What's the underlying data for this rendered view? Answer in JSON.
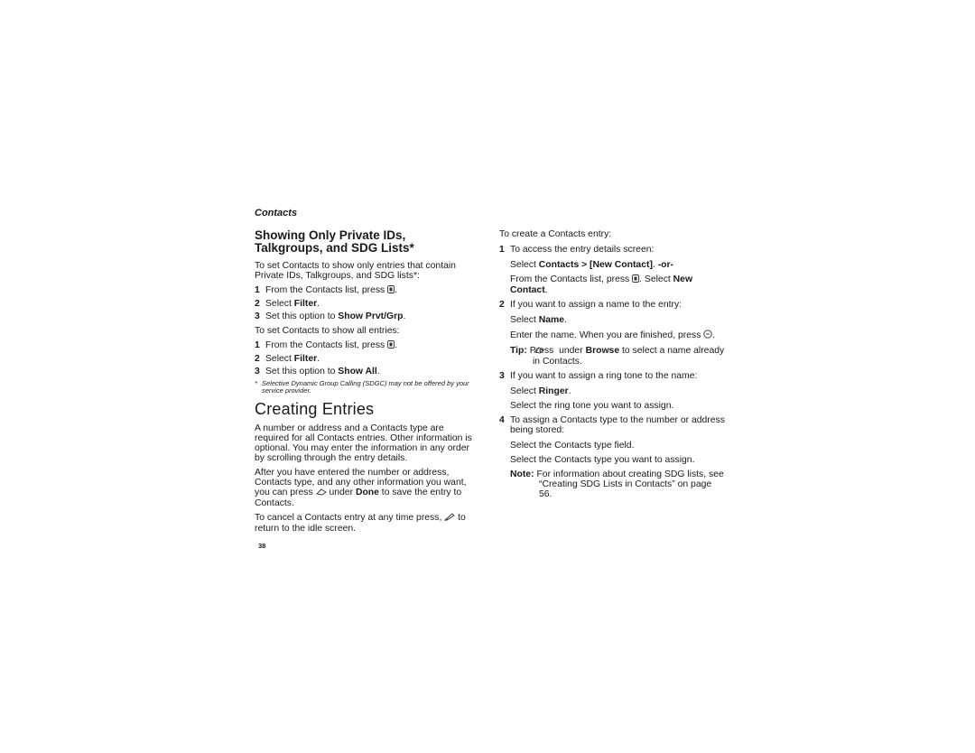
{
  "header": {
    "section": "Contacts"
  },
  "left": {
    "heading_line1": "Showing Only Private IDs,",
    "heading_line2": "Talkgroups, and SDG Lists*",
    "intro": "To set Contacts to show only entries that contain Private IDs, Talkgroups, and SDG lists*:",
    "steps_a": [
      {
        "num": "1",
        "pre": "From the Contacts list, press ",
        "icon": "menu-key-icon",
        "post": "."
      },
      {
        "num": "2",
        "pre": "Select ",
        "bold": "Filter",
        "post": "."
      },
      {
        "num": "3",
        "pre": "Set this option to ",
        "bold": "Show Prvt/Grp",
        "post": "."
      }
    ],
    "intro_all": "To set Contacts to show all entries:",
    "steps_b": [
      {
        "num": "1",
        "pre": "From the Contacts list, press ",
        "icon": "menu-key-icon",
        "post": "."
      },
      {
        "num": "2",
        "pre": "Select ",
        "bold": "Filter",
        "post": "."
      },
      {
        "num": "3",
        "pre": "Set this option to ",
        "bold": "Show All",
        "post": "."
      }
    ],
    "footnote_star": "*",
    "footnote": "Selective Dynamic Group Calling (SDGC) may not be offered by your service provider.",
    "title": "Creating Entries",
    "para1": "A number or address and a Contacts type are required for all Contacts entries. Other information is optional. You may enter the information in any order by scrolling through the entry details.",
    "para2_pre": "After you have entered the number or address, Contacts type, and any other information you want, you can press ",
    "para2_bold": "Done",
    "para2_mid": " under ",
    "para2_post": " to save the entry to Contacts.",
    "para3_pre": "To cancel a Contacts entry at any time press, ",
    "para3_post": " to return to the idle screen."
  },
  "right": {
    "intro": "To create a Contacts entry:",
    "s1_num": "1",
    "s1_text": "To access the entry details screen:",
    "s1_sel_pre": "Select ",
    "s1_sel_bold": "Contacts > [New Contact]",
    "s1_sel_post": ". ",
    "s1_or": "-or-",
    "s1_from_pre": "From the Contacts list, press ",
    "s1_from_mid": ". Select ",
    "s1_from_bold": "New Contact",
    "s1_from_post": ".",
    "s2_num": "2",
    "s2_text": "If you want to assign a name to the entry:",
    "s2_sel_pre": "Select ",
    "s2_sel_bold": "Name",
    "s2_sel_post": ".",
    "s2_enter": "Enter the name. When you are finished, press ",
    "s2_enter_post": ".",
    "tip_label": "Tip:",
    "tip_pre": " Press ",
    "tip_mid": " under ",
    "tip_bold": "Browse",
    "tip_post": " to select a name already in Contacts.",
    "s3_num": "3",
    "s3_text": "If you want to assign a ring tone to the name:",
    "s3_sel_pre": "Select ",
    "s3_sel_bold": "Ringer",
    "s3_sel_post": ".",
    "s3_tone": "Select the ring tone you want to assign.",
    "s4_num": "4",
    "s4_text": "To assign a Contacts type to the number or address being stored:",
    "s4_field": "Select the Contacts type field.",
    "s4_type": "Select the Contacts type you want to assign.",
    "note_label": "Note:",
    "note_text": " For information about creating SDG lists, see “Creating SDG Lists in Contacts” on page 56."
  },
  "footer": {
    "page_number": "38"
  }
}
